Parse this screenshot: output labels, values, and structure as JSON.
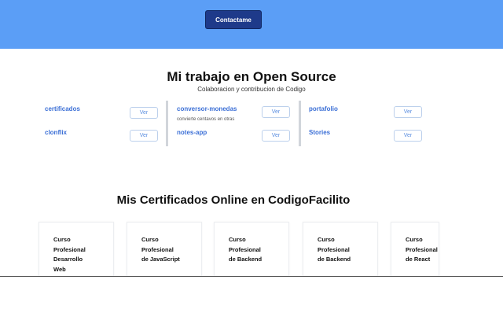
{
  "hero": {
    "contact_button": "Contactame",
    "background": "#5b9ef6",
    "button_color": "#1e3a8a"
  },
  "open_source": {
    "title": "Mi trabajo en Open Source",
    "subtitle": "Colaboracion y contribucion de Codigo",
    "repos": [
      {
        "name": "certificados",
        "description": "",
        "button": "Ver"
      },
      {
        "name": "clonflix",
        "description": "",
        "button": "Ver"
      },
      {
        "name": "conversor-monedas",
        "description": "convierte centavos en otras",
        "button": "Ver"
      },
      {
        "name": "notes-app",
        "description": "",
        "button": "Ver"
      },
      {
        "name": "portafolio",
        "description": "",
        "button": "Ver"
      },
      {
        "name": "Stories",
        "description": "",
        "button": "Ver"
      }
    ],
    "link_color": "#3b6fd6"
  },
  "certificates": {
    "title": "Mis Certificados Online en CodigoFacilito",
    "cards": [
      {
        "text": "Curso\nProfesional\nDesarrollo\nWeb"
      },
      {
        "text": "Curso\nProfesional\nde JavaScript"
      },
      {
        "text": "Curso\nProfesional\nde Backend"
      },
      {
        "text": "Curso\nProfesional\nde Backend"
      },
      {
        "text": "Curso\nProfesional\nde React"
      }
    ]
  }
}
